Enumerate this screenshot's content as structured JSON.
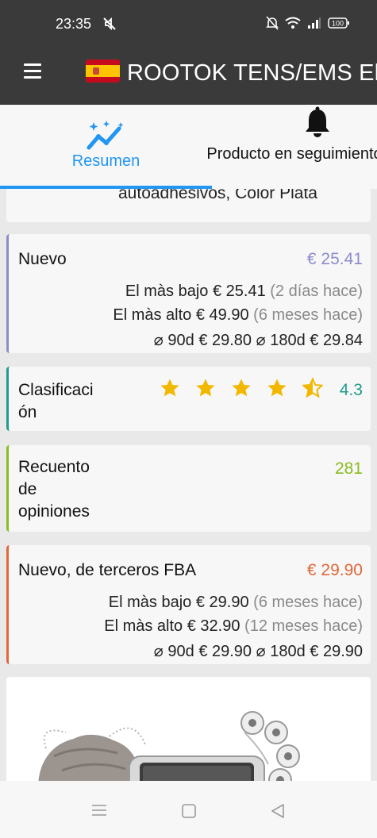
{
  "status_bar": {
    "time": "23:35",
    "battery": "100"
  },
  "app_bar": {
    "title": "ROOTOK TENS/EMS Ele"
  },
  "tabs": [
    {
      "label": "Resumen",
      "icon": "trend-sparkle-icon",
      "selected": true
    },
    {
      "label": "Producto en seguimiento",
      "icon": "bell-icon",
      "selected": false
    }
  ],
  "product_partial_text": "autoadhesivos, Color Plata",
  "nuevo": {
    "label": "Nuevo",
    "price": "€ 25.41",
    "low_label": "El màs bajo",
    "low_price": "€ 25.41",
    "low_when": "(2 días hace)",
    "high_label": "El màs alto",
    "high_price": "€ 49.90",
    "high_when": "(6 meses hace)",
    "avg90_label": "⌀ 90d",
    "avg90": "€ 29.80",
    "avg180_label": "⌀ 180d",
    "avg180": "€ 29.84",
    "color": "#8c8ccc"
  },
  "clasificacion": {
    "label_line1": "Clasificaci",
    "label_line2": "ón",
    "rating": "4.3",
    "rating_value": 4.3,
    "stars_max": 5,
    "color": "#1e9c8a"
  },
  "recuento": {
    "label_line1": "Recuento",
    "label_line2": "de",
    "label_line3": "opiniones",
    "count": "281",
    "color": "#8bbb1e"
  },
  "fba": {
    "label": "Nuevo, de terceros FBA",
    "price": "€ 29.90",
    "low_label": "El màs bajo",
    "low_price": "€ 29.90",
    "low_when": "(6 meses hace)",
    "high_label": "El màs alto",
    "high_price": "€ 32.90",
    "high_when": "(12 meses hace)",
    "avg90_label": "⌀ 90d",
    "avg90": "€ 29.90",
    "avg180_label": "⌀ 180d",
    "avg180": "€ 29.90",
    "color": "#e0683a"
  },
  "colors": {
    "accent_blue": "#2196f3",
    "star_gold": "#f2b800",
    "app_bar_bg": "#3a3a3a"
  }
}
